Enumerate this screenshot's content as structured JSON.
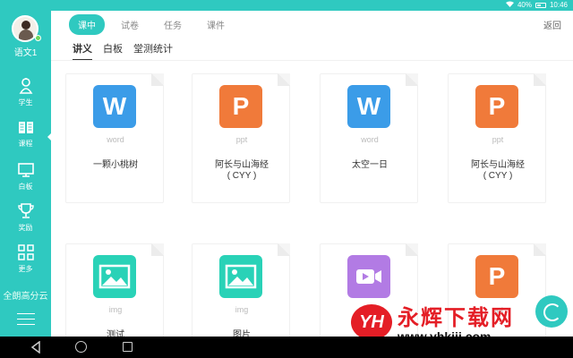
{
  "statusbar": {
    "battery": "40%",
    "time": "10:46"
  },
  "sidebar": {
    "class_name": "语文1",
    "nav": [
      {
        "label": "学生",
        "icon": "student-icon"
      },
      {
        "label": "课程",
        "icon": "book-icon",
        "active": true
      },
      {
        "label": "白板",
        "icon": "whiteboard-icon"
      },
      {
        "label": "奖励",
        "icon": "trophy-icon"
      },
      {
        "label": "更多",
        "icon": "grid-icon"
      }
    ],
    "brand": "全朗高分云"
  },
  "header": {
    "tabs": [
      "课中",
      "试卷",
      "任务",
      "课件"
    ],
    "active_tab": "课中",
    "back": "返回"
  },
  "subtabs": {
    "items": [
      "讲义",
      "白板",
      "堂测统计"
    ],
    "active": "讲义"
  },
  "files": [
    {
      "type": "word",
      "letter": "W",
      "name": "一颗小桃树",
      "color": "#3b9ce8"
    },
    {
      "type": "ppt",
      "letter": "P",
      "name": "阿长与山海经\n( CYY )",
      "color": "#f07a3a"
    },
    {
      "type": "word",
      "letter": "W",
      "name": "太空一日",
      "color": "#3b9ce8"
    },
    {
      "type": "ppt",
      "letter": "P",
      "name": "阿长与山海经\n( CYY )",
      "color": "#f07a3a"
    },
    {
      "type": "img",
      "letter": "",
      "name": "测试",
      "color": "#29d2b7"
    },
    {
      "type": "img",
      "letter": "",
      "name": "图片",
      "color": "#29d2b7"
    },
    {
      "type": "video",
      "letter": "",
      "name": "",
      "color": "#b27be4"
    },
    {
      "type": "ppt",
      "letter": "P",
      "name": "",
      "color": "#f07a3a"
    }
  ],
  "watermark": {
    "logo": "YH",
    "title": "永辉下载网",
    "url": "www.yhkjjj.com"
  }
}
